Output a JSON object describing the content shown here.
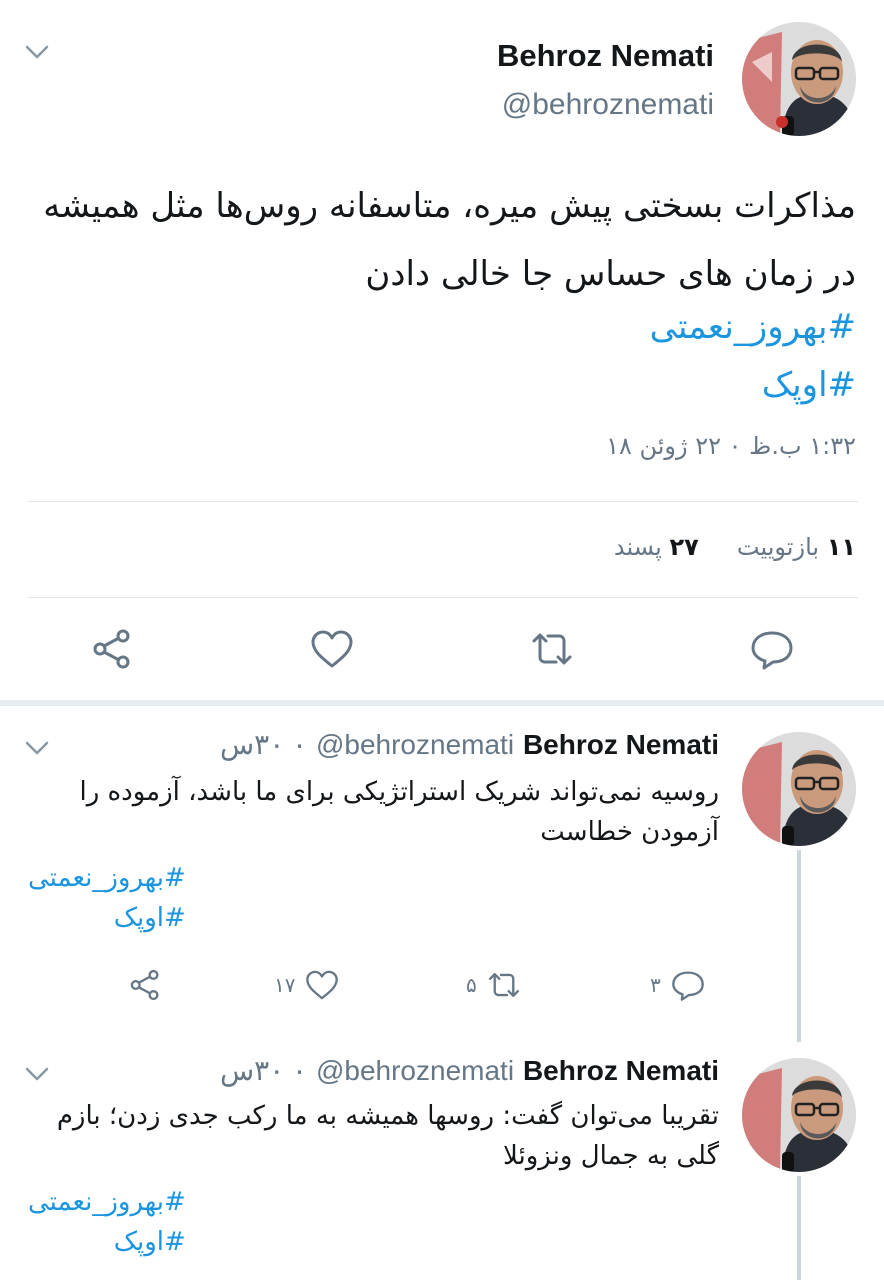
{
  "main_tweet": {
    "author_name": "Behroz Nemati",
    "handle": "@behroznemati",
    "text": "مذاکرات بسختی پیش میره، متاسفانه روس‌ها مثل همیشه در زمان های حساس جا خالی دادن",
    "hashtags": [
      "#بهروز_نعمتی",
      "#اوپک"
    ],
    "timestamp": "۱:۳۲ ب.ظ ۰ ۲۲ ژوئن ۱۸",
    "retweets_count": "۱۱",
    "retweets_label": "بازتوییت",
    "likes_count": "۲۷",
    "likes_label": "پسند"
  },
  "replies": [
    {
      "author_name": "Behroz Nemati",
      "handle": "@behroznemati",
      "time": "۰ ۳۰س",
      "text": "روسیه نمی‌تواند شریک استراتژیکی برای ما باشد، آزموده را آزمودن خطاست",
      "hashtags": [
        "#بهروز_نعمتی",
        "#اوپک"
      ],
      "reply_count": "۳",
      "retweet_count": "۵",
      "like_count": "۱۷"
    },
    {
      "author_name": "Behroz Nemati",
      "handle": "@behroznemati",
      "time": "۰ ۳۰س",
      "text": "تقریبا می‌توان گفت: روسها همیشه به ما رکب جدی زدن؛ بازم گلی به جمال ونزوئلا",
      "hashtags": [
        "#بهروز_نعمتی",
        "#اوپک"
      ]
    }
  ],
  "icons": {
    "chevron": "chevron-down-icon",
    "reply": "reply-icon",
    "retweet": "retweet-icon",
    "like": "heart-icon",
    "share": "share-icon"
  },
  "colors": {
    "hashtag": "#1b95e0",
    "secondary_text": "#657786",
    "icon": "#657786",
    "divider": "#e1e8ed"
  }
}
